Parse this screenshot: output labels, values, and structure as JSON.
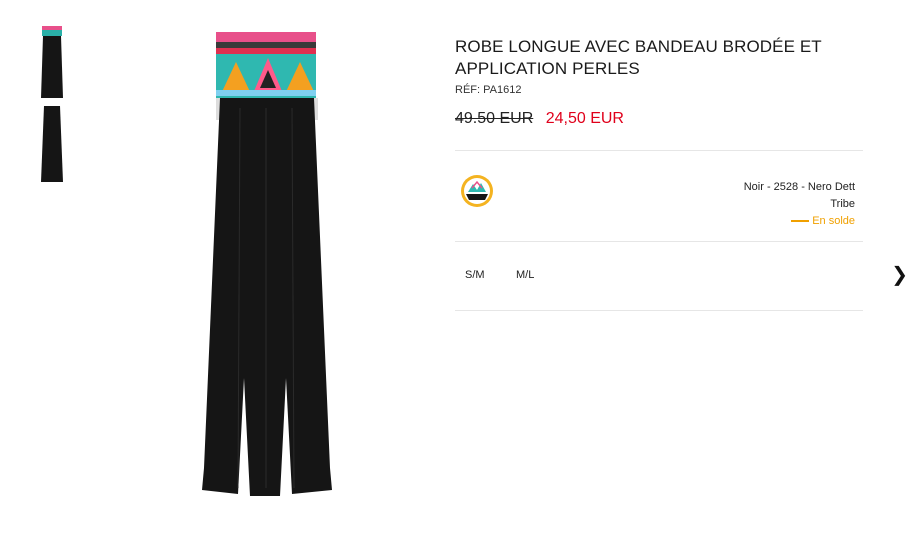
{
  "product": {
    "title": "ROBE LONGUE AVEC BANDEAU BRODÉE ET APPLICATION PERLES",
    "ref": "RÉF: PA1612",
    "old_price": "49.50 EUR",
    "new_price": "24,50 EUR"
  },
  "variant": {
    "color_line1": "Noir - 2528 - Nero Dett",
    "color_line2": "Tribe",
    "sale_label": "En solde"
  },
  "sizes": [
    "S/M",
    "M/L"
  ],
  "colors": {
    "sale_price": "#e0001b",
    "sale_tag": "#f0a000",
    "dress": "#151515"
  },
  "icons": {
    "next": "chevron-right-icon",
    "swatch": "color-swatch-icon"
  }
}
